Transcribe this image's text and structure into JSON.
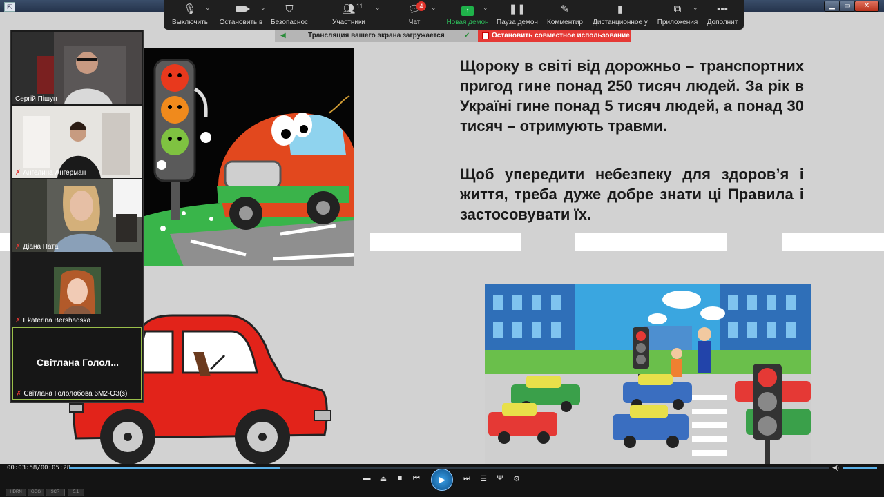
{
  "toolbar": {
    "buttons": [
      {
        "label": "Выключить",
        "icon": "microphone-icon"
      },
      {
        "label": "Остановить в",
        "icon": "video-camera-icon"
      },
      {
        "label": "Безопаснос",
        "icon": "shield-icon"
      },
      {
        "label": "Участники",
        "icon": "participants-icon",
        "count": "11"
      },
      {
        "label": "Чат",
        "icon": "chat-icon",
        "badge": "4"
      },
      {
        "label": "Новая демон",
        "icon": "share-screen-icon"
      },
      {
        "label": "Пауза демон",
        "icon": "pause-icon"
      },
      {
        "label": "Комментир",
        "icon": "pen-icon"
      },
      {
        "label": "Дистанционное у",
        "icon": "mouse-icon"
      },
      {
        "label": "Приложения",
        "icon": "apps-icon"
      },
      {
        "label": "Дополнит",
        "icon": "more-icon"
      }
    ]
  },
  "share": {
    "status": "Трансляция вашего экрана загружается",
    "stop_label": "Остановить совместное использование"
  },
  "participants": [
    {
      "name": "Сергій Пішун",
      "muted": false
    },
    {
      "name": "Ангелина Ангерман",
      "muted": true
    },
    {
      "name": "Діана Пата",
      "muted": true
    },
    {
      "name": "Ekaterina Bershadska",
      "muted": true
    },
    {
      "name": "Світлана Гололобова 6М2-ОЗ(з)",
      "muted": true,
      "display": "Світлана  Голол..."
    }
  ],
  "slide": {
    "paragraph1": "Щороку в світі від дорожньо – транспортних пригод гине понад 250 тисяч людей. За рік в Україні гине понад 5 тисяч людей, а понад 30 тисяч – отримують травми.",
    "paragraph2": "Щоб упередити небезпеку для здоров’я і життя, треба дуже добре знати ці Правила і застосовувати їх."
  },
  "player": {
    "time": "00:03:58/00:05:28",
    "progress": 0.278,
    "pills": [
      "HDRN",
      "GGG",
      "SCR",
      "5.1"
    ]
  },
  "colors": {
    "zoom_green": "#2dbb5a",
    "stop_red": "#e53935",
    "player_blue": "#5ab0e8"
  }
}
